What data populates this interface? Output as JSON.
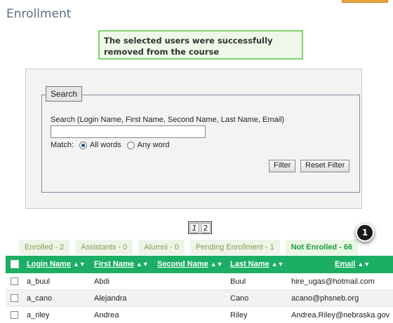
{
  "page": {
    "title": "Enrollment"
  },
  "message": {
    "text": "The selected users were successfully removed from the course",
    "color": "#7fd36a"
  },
  "search": {
    "legend": "Search",
    "label": "Search (Login Name, First Name, Second Name, Last Name, Email)",
    "value": "",
    "placeholder": "",
    "match_label": "Match:",
    "option_all": "All words",
    "option_any": "Any word",
    "selected": "All words",
    "filter_label": "Filter",
    "reset_label": "Reset Filter"
  },
  "pagination": {
    "pages": [
      "1",
      "2"
    ],
    "current": "1"
  },
  "tabs": [
    {
      "label": "Enrolled - 2",
      "active": false
    },
    {
      "label": "Assistants - 0",
      "active": false
    },
    {
      "label": "Alumni - 0",
      "active": false
    },
    {
      "label": "Pending Enrollment - 1",
      "active": false
    },
    {
      "label": "Not Enrolled - 66",
      "active": true
    }
  ],
  "callout": {
    "number": "1"
  },
  "table": {
    "header_color": "#1cae64",
    "columns": [
      "Login Name",
      "First Name",
      "Second Name",
      "Last Name",
      "Email"
    ],
    "rows": [
      [
        "a_buul",
        "Abdi",
        "",
        "Buul",
        "hire_ugas@hotmail.com"
      ],
      [
        "a_cano",
        "Alejandra",
        "",
        "Cano",
        "acano@phsneb.org"
      ],
      [
        "a_riley",
        "Andrea",
        "",
        "Riley",
        "Andrea.Riley@nebraska.gov"
      ]
    ]
  }
}
